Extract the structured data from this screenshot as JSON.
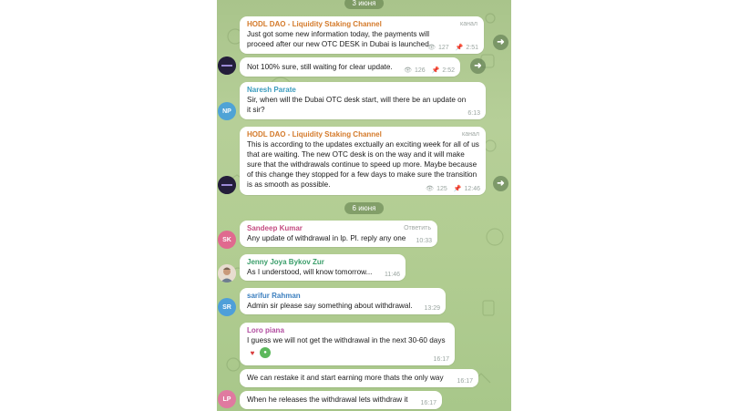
{
  "dates": {
    "first": "3 июня",
    "second": "6 июня"
  },
  "messages": [
    {
      "sender": "HODL DAO - Liquidity Staking Channel",
      "tag": "канал",
      "text": "Just got some new information today, the payments will proceed after our new OTC DESK in Dubai is launched",
      "views": "127",
      "time": "2:51"
    },
    {
      "text": "Not 100% sure, still waiting for clear update.",
      "views": "126",
      "time": "2:52"
    },
    {
      "sender": "Naresh Parate",
      "avatar": "NP",
      "text": "Sir, when will the Dubai OTC desk start, will there be an update on it sir?",
      "time": "6:13"
    },
    {
      "sender": "HODL DAO - Liquidity Staking Channel",
      "tag": "канал",
      "text": "This is according to the updates exctually an exciting week for all of us that are waiting. The new OTC desk is on the way and it will make sure that the withdrawals continue to speed up more. Maybe because of this change they stopped for a few days to make sure the transition is as smooth as possible.",
      "views": "125",
      "time": "12:46"
    },
    {
      "sender": "Sandeep Kumar",
      "avatar": "SK",
      "tag": "Ответить",
      "text": "Any update of withdrawal in lp. Pl. reply any one",
      "time": "10:33"
    },
    {
      "sender": "Jenny Joya Bykov Zur",
      "text": "As I understood, will know tomorrow...",
      "time": "11:46"
    },
    {
      "sender": "sarifur Rahman",
      "avatar": "SR",
      "text": "Admin sir please say something about withdrawal.",
      "time": "13:29"
    },
    {
      "sender": "Loro piana",
      "text": "I guess we will not get the withdrawal in the next 30-60 days",
      "time": "16:17"
    },
    {
      "text": "We can restake it and start earning more thats the only way",
      "time": "16:17"
    },
    {
      "avatar": "LP",
      "text": "When he releases the withdrawal lets withdraw it",
      "time": "16:17"
    }
  ],
  "colors": {
    "channel": "#d47a2a",
    "np": "#3a9bbd",
    "sk": "#c44d82",
    "jenny": "#3a9e6a",
    "sr": "#3c7fbf",
    "lp": "#b24da0"
  }
}
